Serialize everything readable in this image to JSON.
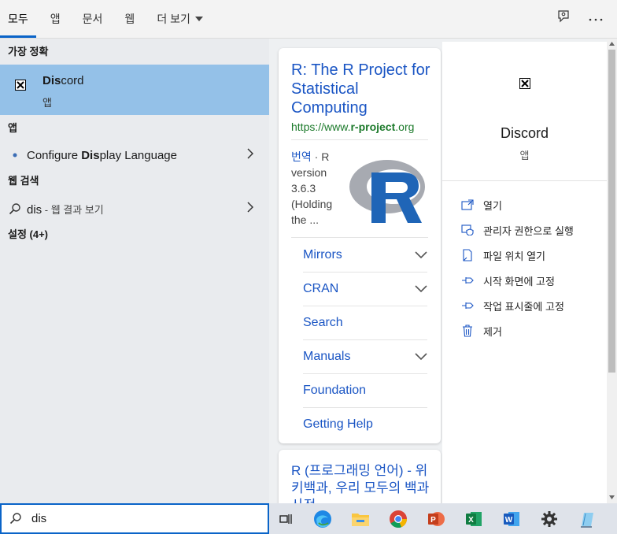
{
  "tabs": [
    {
      "label": "모두"
    },
    {
      "label": "앱"
    },
    {
      "label": "문서"
    },
    {
      "label": "웹"
    },
    {
      "label": "더 보기"
    }
  ],
  "left": {
    "best_match_label": "가장 정확",
    "best_match": {
      "name_bold": "Dis",
      "name_rest": "cord",
      "sub": "앱"
    },
    "apps_label": "앱",
    "app_item": {
      "pre": "Configure ",
      "bold": "Dis",
      "post": "play Language"
    },
    "web_label": "웹 검색",
    "web_item": {
      "query": "dis",
      "suffix": " - 웹 결과 보기"
    },
    "settings_label": "설정 (4+)"
  },
  "card1": {
    "title": "R: The R Project for Statistical Computing",
    "url_pre": "https://www.",
    "url_bold": "r-project",
    "url_post": ".org",
    "snippet_translate": "번역",
    "snippet_text": " · R version 3.6.3 (Holding the ...",
    "links": [
      {
        "label": "Mirrors",
        "expand": true
      },
      {
        "label": "CRAN",
        "expand": true
      },
      {
        "label": "Search",
        "expand": false
      },
      {
        "label": "Manuals",
        "expand": true
      },
      {
        "label": "Foundation",
        "expand": false
      },
      {
        "label": "Getting Help",
        "expand": false
      }
    ]
  },
  "card2": {
    "title": "R (프로그래밍 언어) - 위키백과, 우리 모두의 백과사전"
  },
  "panel": {
    "name": "Discord",
    "sub": "앱",
    "actions": [
      {
        "label": "열기",
        "icon": "open-icon"
      },
      {
        "label": "관리자 권한으로 실행",
        "icon": "admin-shield-icon"
      },
      {
        "label": "파일 위치 열기",
        "icon": "file-location-icon"
      },
      {
        "label": "시작 화면에 고정",
        "icon": "pin-start-icon"
      },
      {
        "label": "작업 표시줄에 고정",
        "icon": "pin-taskbar-icon"
      },
      {
        "label": "제거",
        "icon": "trash-icon"
      }
    ]
  },
  "search": {
    "value": "dis"
  },
  "taskbar": {
    "icons": [
      "task-view-icon",
      "edge-icon",
      "file-explorer-icon",
      "chrome-icon",
      "powerpoint-icon",
      "excel-icon",
      "word-icon",
      "settings-icon",
      "notepad-icon"
    ]
  },
  "colors": {
    "accent": "#0a64c8",
    "highlight": "#94c1e8",
    "link": "#1a55c4",
    "url": "#1c7a2b"
  }
}
